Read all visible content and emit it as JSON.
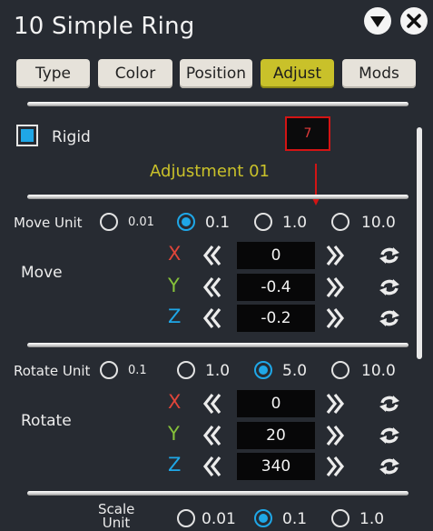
{
  "window": {
    "title": "10 Simple Ring"
  },
  "icons": {
    "collapse": "triangle-down-icon",
    "close": "close-x-icon",
    "reset": "reset-arrows-icon",
    "left": "double-chevron-left-icon",
    "right": "double-chevron-right-icon"
  },
  "tabs": [
    {
      "label": "Type",
      "active": false
    },
    {
      "label": "Color",
      "active": false
    },
    {
      "label": "Position",
      "active": false
    },
    {
      "label": "Adjust",
      "active": true
    },
    {
      "label": "Mods",
      "active": false
    }
  ],
  "rigid": {
    "label": "Rigid",
    "checked": true
  },
  "badge": {
    "value": "7"
  },
  "adjustment_title": "Adjustment 01",
  "move": {
    "unit_label": "Move Unit",
    "units": [
      "0.01",
      "0.1",
      "1.0",
      "10.0"
    ],
    "selected_unit": "0.1",
    "section_label": "Move",
    "axes": [
      {
        "name": "X",
        "value": "0"
      },
      {
        "name": "Y",
        "value": "-0.4"
      },
      {
        "name": "Z",
        "value": "-0.2"
      }
    ]
  },
  "rotate": {
    "unit_label": "Rotate Unit",
    "units": [
      "0.1",
      "1.0",
      "5.0",
      "10.0"
    ],
    "selected_unit": "5.0",
    "section_label": "Rotate",
    "axes": [
      {
        "name": "X",
        "value": "0"
      },
      {
        "name": "Y",
        "value": "20"
      },
      {
        "name": "Z",
        "value": "340"
      }
    ]
  },
  "scale": {
    "unit_label": "Scale Unit",
    "units": [
      "0.01",
      "0.1",
      "1.0"
    ],
    "selected_unit": "0.1"
  },
  "colors": {
    "accent": "#c9c12a",
    "radio": "#1fa7e7",
    "x": "#e0453a",
    "y": "#86c23a",
    "z": "#1fa7e7",
    "badge_border": "#d31414"
  }
}
